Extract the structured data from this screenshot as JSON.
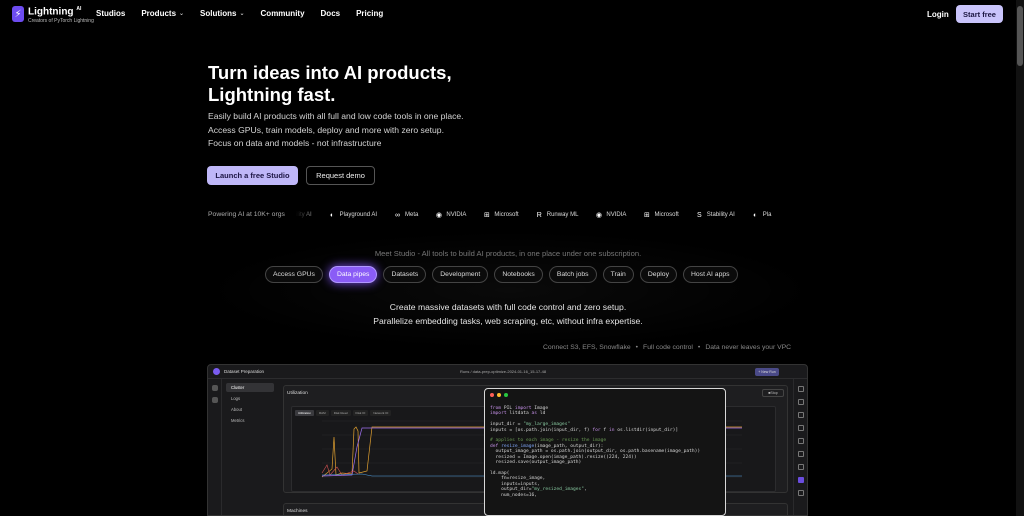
{
  "brand": {
    "name": "Lightning",
    "badge": "AI",
    "tagline": "Creators of PyTorch Lightning"
  },
  "nav": {
    "items": [
      {
        "label": "Studios",
        "dropdown": false
      },
      {
        "label": "Products",
        "dropdown": true
      },
      {
        "label": "Solutions",
        "dropdown": true
      },
      {
        "label": "Community",
        "dropdown": false
      },
      {
        "label": "Docs",
        "dropdown": false
      },
      {
        "label": "Pricing",
        "dropdown": false
      }
    ],
    "login": "Login",
    "start": "Start free"
  },
  "hero": {
    "title_line1": "Turn ideas into AI products,",
    "title_line2": "Lightning fast.",
    "desc_line1": "Easily build AI products with all full and low code tools in one place.",
    "desc_line2": "Access GPUs, train models, deploy and more with zero setup.",
    "desc_line3": "Focus on data and models - not infrastructure",
    "cta_primary": "Launch a free Studio",
    "cta_secondary": "Request demo"
  },
  "logos": {
    "label": "Powering AI at 10K+ orgs",
    "items": [
      "ility AI",
      "Playground AI",
      "Meta",
      "NVIDIA",
      "Microsoft",
      "Runway ML",
      "NVIDIA",
      "Microsoft",
      "Stability AI",
      "Pla"
    ]
  },
  "studio": {
    "intro": "Meet Studio - All tools to build AI products, in one place under one subscription.",
    "tabs": [
      "Access GPUs",
      "Data pipes",
      "Datasets",
      "Development",
      "Notebooks",
      "Batch jobs",
      "Train",
      "Deploy",
      "Host AI apps"
    ],
    "active_tab": "Data pipes",
    "desc_line1": "Create massive datasets with full code control and zero setup.",
    "desc_line2": "Parallelize embedding tasks, web scraping, etc, without infra expertise.",
    "features": [
      "Connect S3, EFS, Snowflake",
      "Full code control",
      "Data never leaves your VPC"
    ]
  },
  "app": {
    "title": "Dataset Preparation",
    "run": "Runs / data-prep-optimize-2024-01-16_15-17-48",
    "new_run": "+ New Run",
    "sidebar": [
      "Cluster",
      "Logs",
      "About",
      "Metrics"
    ],
    "panel_title": "Utilization",
    "stop": "Stop",
    "metric_tabs": [
      "Utilization",
      "RAM",
      "Disk Read",
      "Disk IO",
      "Network IO"
    ],
    "panel2_title": "Machines",
    "accent": "#8a5cf6"
  },
  "code": {
    "lines": [
      [
        "kw:from ",
        "PIL ",
        "kw:import ",
        "Image"
      ],
      [
        "kw:import ",
        "litdata ",
        "kw:as ",
        "ld"
      ],
      [
        ""
      ],
      [
        "input_dir = ",
        "st:\"my_large_images\""
      ],
      [
        "inputs = [os.path.join(input_dir, f) ",
        "kw:for ",
        "f ",
        "kw:in ",
        "os.listdir(input_dir)]"
      ],
      [
        ""
      ],
      [
        "cm:# applies to each image - resize the image"
      ],
      [
        "kw:def ",
        "fn:resize_image",
        "(image_path, output_dir):"
      ],
      [
        "  output_image_path = os.path.join(output_dir, os.path.basename(image_path))"
      ],
      [
        "  resized = Image.open(image_path).resize((224, 224))"
      ],
      [
        "  resized.save(output_image_path)"
      ],
      [
        ""
      ],
      [
        "ld.map("
      ],
      [
        "    fn=resize_image,"
      ],
      [
        "    inputs=inputs,"
      ],
      [
        "    output_dir=",
        "st:\"my_resized_images\"",
        ","
      ],
      [
        "    num_nodes=16,"
      ]
    ]
  }
}
